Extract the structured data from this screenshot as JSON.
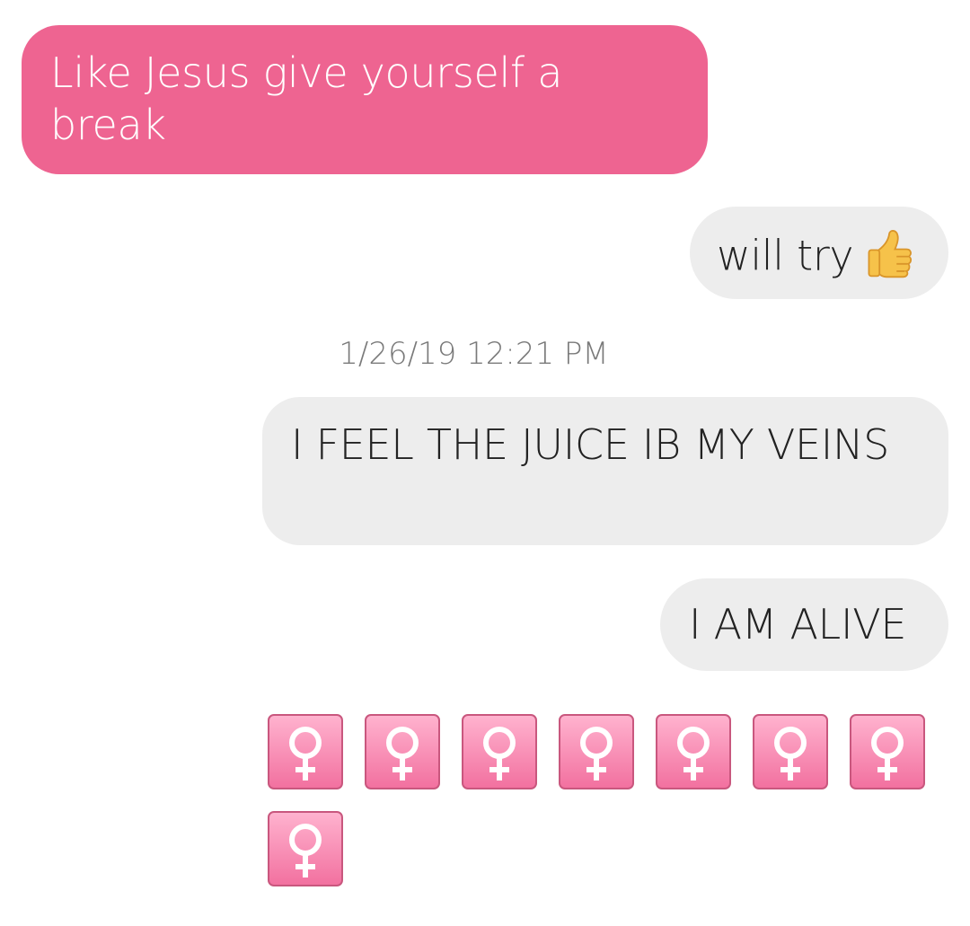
{
  "messages": [
    {
      "direction": "incoming",
      "text": "Like Jesus give yourself a break"
    },
    {
      "direction": "outgoing",
      "text": "will try",
      "emoji": "thumbs-up-icon"
    },
    {
      "direction": "outgoing",
      "text": "I FEEL THE JUICE IB MY VEINS"
    },
    {
      "direction": "outgoing",
      "text": "I AM ALIVE"
    }
  ],
  "timestamp": "1/26/19 12:21 PM",
  "emoji_row": {
    "icon": "female-sign-icon",
    "count": 8
  },
  "colors": {
    "incoming_bubble": "#ee6491",
    "outgoing_bubble": "#ededed",
    "incoming_text": "#ffffff",
    "outgoing_text": "#222222",
    "timestamp_text": "#7a7a7a",
    "emoji_tile": "#f2709f"
  }
}
